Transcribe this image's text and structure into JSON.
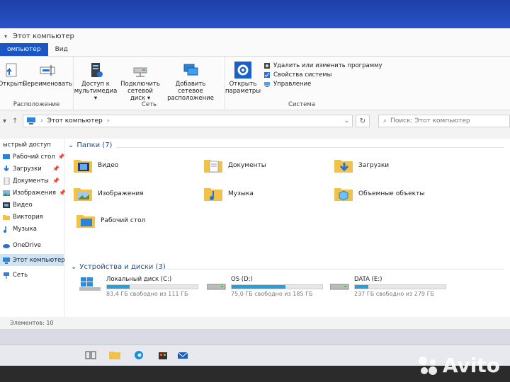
{
  "window": {
    "title": "Этот компьютер",
    "tabs": [
      {
        "label": "омпьютер",
        "active": true
      },
      {
        "label": "Вид",
        "active": false
      }
    ]
  },
  "ribbon": {
    "groups": [
      {
        "label": "Расположение",
        "buttons": [
          "Открыть",
          "Переименовать"
        ]
      },
      {
        "label": "Сеть",
        "buttons": [
          "Доступ к\nмультимедиа ▾",
          "Подключить\nсетевой диск ▾",
          "Добавить сетевое\nрасположение"
        ]
      },
      {
        "label": "Система",
        "buttons": [
          "Открыть\nпараметры"
        ],
        "small": [
          "Удалить или изменить программу",
          "Свойства системы",
          "Управление"
        ]
      }
    ]
  },
  "address": {
    "path": "Этот компьютер",
    "search_placeholder": "Поиск: Этот компьютер"
  },
  "nav": {
    "items": [
      {
        "label": "ыстрый доступ",
        "pinned": false,
        "selected": false
      },
      {
        "label": "Рабочий стол",
        "pinned": true,
        "selected": false
      },
      {
        "label": "Загрузки",
        "pinned": true,
        "selected": false
      },
      {
        "label": "Документы",
        "pinned": true,
        "selected": false
      },
      {
        "label": "Изображения",
        "pinned": true,
        "selected": false
      },
      {
        "label": "Видео",
        "pinned": false,
        "selected": false
      },
      {
        "label": "Виктория",
        "pinned": false,
        "selected": false
      },
      {
        "label": "Музыка",
        "pinned": false,
        "selected": false
      },
      {
        "label": "OneDrive",
        "pinned": false,
        "selected": false
      },
      {
        "label": "Этот компьютер",
        "pinned": false,
        "selected": true
      },
      {
        "label": "Сеть",
        "pinned": false,
        "selected": false
      }
    ]
  },
  "folders": {
    "header": "Папки (7)",
    "items": [
      "Видео",
      "Документы",
      "Загрузки",
      "Изображения",
      "Музыка",
      "Объемные объекты",
      "Рабочий стол"
    ]
  },
  "drives": {
    "header": "Устройства и диски (3)",
    "items": [
      {
        "name": "Локальный диск (C:)",
        "free": "83,4 ГБ свободно из 111 ГБ",
        "used_fraction": 0.25
      },
      {
        "name": "OS (D:)",
        "free": "75,0 ГБ свободно из 185 ГБ",
        "used_fraction": 0.59
      },
      {
        "name": "DATA (E:)",
        "free": "237 ГБ свободно из 279 ГБ",
        "used_fraction": 0.15
      }
    ]
  },
  "status": {
    "text": "Элементов: 10"
  },
  "watermark": {
    "text": "Avito"
  },
  "colors": {
    "accent": "#1a56c4",
    "drive_bar": "#26a0da",
    "folder": "#f0c24a"
  }
}
